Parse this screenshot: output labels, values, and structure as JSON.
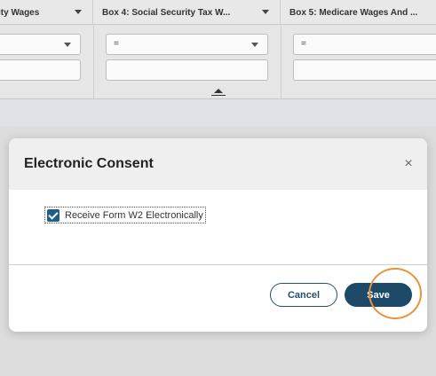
{
  "grid": {
    "columns": [
      {
        "label": "ity Wages"
      },
      {
        "label": "Box 4: Social Security Tax W..."
      },
      {
        "label": "Box 5: Medicare Wages And ..."
      }
    ],
    "filters": [
      {
        "operator": ""
      },
      {
        "operator": "="
      },
      {
        "operator": "="
      }
    ]
  },
  "modal": {
    "title": "Electronic Consent",
    "close_glyph": "×",
    "consent_label": "Receive Form W2 Electronically",
    "consent_checked": true,
    "cancel_label": "Cancel",
    "save_label": "Save"
  },
  "colors": {
    "primary": "#1d4a69",
    "checkbox": "#1e5f8a",
    "highlight": "#e8923a"
  }
}
